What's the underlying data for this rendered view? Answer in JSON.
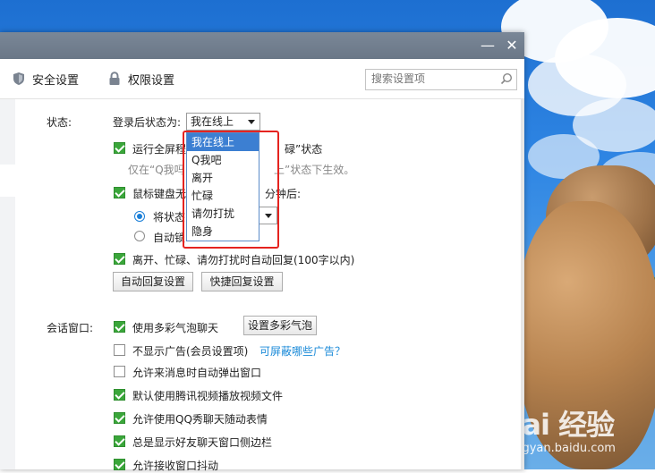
{
  "window": {
    "minimize": "—",
    "close": "✕"
  },
  "toolbar": {
    "security_label": "安全设置",
    "permission_label": "权限设置",
    "search_placeholder": "搜索设置项"
  },
  "status": {
    "section_label": "状态:",
    "login_status_label": "登录后状态为:",
    "login_status_value": "我在线上",
    "fullscreen_label_a": "运行全屏程",
    "fullscreen_label_b": "碌”状态",
    "fullscreen_note_a": "仅在“Q我吗",
    "fullscreen_note_b": "上”状态下生效。",
    "idle_label_a": "鼠标键盘无",
    "idle_label_b": "分钟后:",
    "radio_change_a": "将状态",
    "radio_autolock_a": "自动锁",
    "auto_reply_label": "离开、忙碌、请勿打扰时自动回复(100字以内)",
    "auto_reply_btn": "自动回复设置",
    "quick_reply_btn": "快捷回复设置"
  },
  "dropdown": {
    "options": [
      "我在线上",
      "Q我吧",
      "离开",
      "忙碌",
      "请勿打扰",
      "隐身"
    ],
    "selected_index": 0
  },
  "session": {
    "section_label": "会话窗口:",
    "bubble_label": "使用多彩气泡聊天",
    "bubble_btn": "设置多彩气泡",
    "no_ads_label": "不显示广告(会员设置项)",
    "ads_link": "可屏蔽哪些广告？",
    "auto_popup_label": "允许来消息时自动弹出窗口",
    "tencent_video_label": "默认使用腾讯视频播放视频文件",
    "qq_show_label": "允许使用QQ秀聊天随动表情",
    "sidebar_label": "总是显示好友聊天窗口侧边栏",
    "shake_label": "允许接收窗口抖动"
  },
  "watermark": {
    "logo": "Bai 经验",
    "url": "jingyan.baidu.com"
  },
  "colors": {
    "checkbox_on": "#3aa63a",
    "highlight_box": "#e5231f",
    "dropdown_selected": "#3c7fd2",
    "link": "#1a8ad8"
  }
}
